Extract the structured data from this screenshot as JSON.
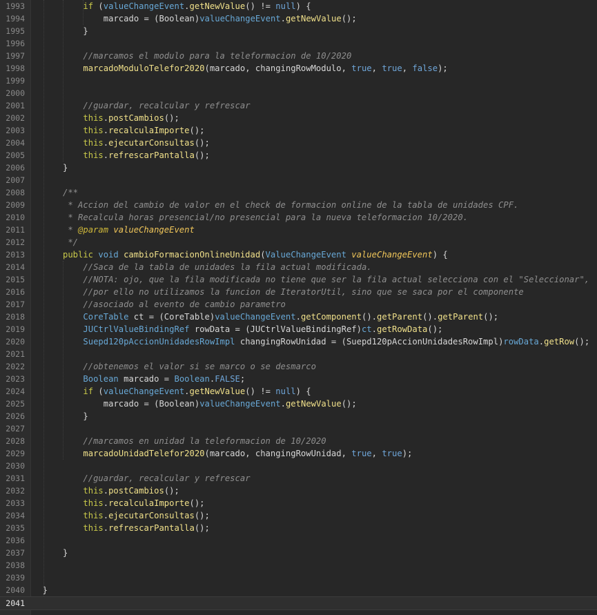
{
  "editor": {
    "current_line": "2041",
    "lines": [
      {
        "n": "1993",
        "indent": 4,
        "tokens": [
          [
            "kw",
            "if"
          ],
          [
            "pl",
            " ("
          ],
          [
            "ty",
            "valueChangeEvent"
          ],
          [
            "pl",
            "."
          ],
          [
            "fn",
            "getNewValue"
          ],
          [
            "pl",
            "() != "
          ],
          [
            "lt",
            "null"
          ],
          [
            "pl",
            ") {"
          ]
        ]
      },
      {
        "n": "1994",
        "indent": 8,
        "tokens": [
          [
            "pl",
            "marcado = (Boolean)"
          ],
          [
            "ty",
            "valueChangeEvent"
          ],
          [
            "pl",
            "."
          ],
          [
            "fn",
            "getNewValue"
          ],
          [
            "pl",
            "();"
          ]
        ]
      },
      {
        "n": "1995",
        "indent": 4,
        "tokens": [
          [
            "pl",
            "}"
          ]
        ]
      },
      {
        "n": "1996",
        "indent": 0,
        "tokens": []
      },
      {
        "n": "1997",
        "indent": 4,
        "tokens": [
          [
            "cm",
            "//marcamos el modulo para la teleformacion de 10/2020"
          ]
        ]
      },
      {
        "n": "1998",
        "indent": 4,
        "tokens": [
          [
            "fn",
            "marcadoModuloTelefor2020"
          ],
          [
            "pl",
            "(marcado, changingRowModulo, "
          ],
          [
            "lt",
            "true"
          ],
          [
            "pl",
            ", "
          ],
          [
            "lt",
            "true"
          ],
          [
            "pl",
            ", "
          ],
          [
            "lt",
            "false"
          ],
          [
            "pl",
            ");"
          ]
        ]
      },
      {
        "n": "1999",
        "indent": 0,
        "tokens": []
      },
      {
        "n": "2000",
        "indent": 0,
        "tokens": []
      },
      {
        "n": "2001",
        "indent": 4,
        "tokens": [
          [
            "cm",
            "//guardar, recalcular y refrescar"
          ]
        ]
      },
      {
        "n": "2002",
        "indent": 4,
        "tokens": [
          [
            "kw",
            "this"
          ],
          [
            "pl",
            "."
          ],
          [
            "fn",
            "postCambios"
          ],
          [
            "pl",
            "();"
          ]
        ]
      },
      {
        "n": "2003",
        "indent": 4,
        "tokens": [
          [
            "kw",
            "this"
          ],
          [
            "pl",
            "."
          ],
          [
            "fn",
            "recalculaImporte"
          ],
          [
            "pl",
            "();"
          ]
        ]
      },
      {
        "n": "2004",
        "indent": 4,
        "tokens": [
          [
            "kw",
            "this"
          ],
          [
            "pl",
            "."
          ],
          [
            "fn",
            "ejecutarConsultas"
          ],
          [
            "pl",
            "();"
          ]
        ]
      },
      {
        "n": "2005",
        "indent": 4,
        "tokens": [
          [
            "kw",
            "this"
          ],
          [
            "pl",
            "."
          ],
          [
            "fn",
            "refrescarPantalla"
          ],
          [
            "pl",
            "();"
          ]
        ]
      },
      {
        "n": "2006",
        "indent": 0,
        "tokens": [
          [
            "pl",
            "}"
          ]
        ]
      },
      {
        "n": "2007",
        "indent": 0,
        "tokens": []
      },
      {
        "n": "2008",
        "indent": 0,
        "tokens": [
          [
            "cm",
            "/**"
          ]
        ]
      },
      {
        "n": "2009",
        "indent": 0,
        "tokens": [
          [
            "cm",
            " * Accion del cambio de valor en el check de formacion online de la tabla de unidades CPF."
          ]
        ]
      },
      {
        "n": "2010",
        "indent": 0,
        "tokens": [
          [
            "cm",
            " * Recalcula horas presencial/no presencial para la nueva teleformacion 10/2020."
          ]
        ]
      },
      {
        "n": "2011",
        "indent": 0,
        "tokens": [
          [
            "cm",
            " * "
          ],
          [
            "an",
            "@param"
          ],
          [
            "cm",
            " "
          ],
          [
            "pn",
            "valueChangeEvent"
          ]
        ]
      },
      {
        "n": "2012",
        "indent": 0,
        "tokens": [
          [
            "cm",
            " */"
          ]
        ]
      },
      {
        "n": "2013",
        "indent": 0,
        "tokens": [
          [
            "kw",
            "public"
          ],
          [
            "pl",
            " "
          ],
          [
            "ty",
            "void"
          ],
          [
            "pl",
            " "
          ],
          [
            "fn",
            "cambioFormacionOnlineUnidad"
          ],
          [
            "pl",
            "("
          ],
          [
            "ty",
            "ValueChangeEvent"
          ],
          [
            "pl",
            " "
          ],
          [
            "pn",
            "valueChangeEvent"
          ],
          [
            "pl",
            ") {"
          ]
        ]
      },
      {
        "n": "2014",
        "indent": 4,
        "tokens": [
          [
            "cm",
            "//Saca de la tabla de unidades la fila actual modificada."
          ]
        ]
      },
      {
        "n": "2015",
        "indent": 4,
        "tokens": [
          [
            "cm",
            "//NOTA: ojo, que la fila modificada no tiene que ser la fila actual selecciona con el \"Seleccionar\","
          ]
        ]
      },
      {
        "n": "2016",
        "indent": 4,
        "tokens": [
          [
            "cm",
            "//por ello no utilizamos la funcion de IteratorUtil, sino que se saca por el componente"
          ]
        ]
      },
      {
        "n": "2017",
        "indent": 4,
        "tokens": [
          [
            "cm",
            "//asociado al evento de cambio parametro"
          ]
        ]
      },
      {
        "n": "2018",
        "indent": 4,
        "tokens": [
          [
            "ty",
            "CoreTable"
          ],
          [
            "pl",
            " ct = (CoreTable)"
          ],
          [
            "ty",
            "valueChangeEvent"
          ],
          [
            "pl",
            "."
          ],
          [
            "fn",
            "getComponent"
          ],
          [
            "pl",
            "()."
          ],
          [
            "fn",
            "getParent"
          ],
          [
            "pl",
            "()."
          ],
          [
            "fn",
            "getParent"
          ],
          [
            "pl",
            "();"
          ]
        ]
      },
      {
        "n": "2019",
        "indent": 4,
        "tokens": [
          [
            "ty",
            "JUCtrlValueBindingRef"
          ],
          [
            "pl",
            " rowData = (JUCtrlValueBindingRef)"
          ],
          [
            "ty",
            "ct"
          ],
          [
            "pl",
            "."
          ],
          [
            "fn",
            "getRowData"
          ],
          [
            "pl",
            "();"
          ]
        ]
      },
      {
        "n": "2020",
        "indent": 4,
        "tokens": [
          [
            "ty",
            "Suepd120pAccionUnidadesRowImpl"
          ],
          [
            "pl",
            " changingRowUnidad = (Suepd120pAccionUnidadesRowImpl)"
          ],
          [
            "ty",
            "rowData"
          ],
          [
            "pl",
            "."
          ],
          [
            "fn",
            "getRow"
          ],
          [
            "pl",
            "();"
          ]
        ]
      },
      {
        "n": "2021",
        "indent": 0,
        "tokens": []
      },
      {
        "n": "2022",
        "indent": 4,
        "tokens": [
          [
            "cm",
            "//obtenemos el valor si se marco o se desmarco"
          ]
        ]
      },
      {
        "n": "2023",
        "indent": 4,
        "tokens": [
          [
            "ty",
            "Boolean"
          ],
          [
            "pl",
            " marcado = "
          ],
          [
            "ty",
            "Boolean"
          ],
          [
            "pl",
            "."
          ],
          [
            "lt",
            "FALSE"
          ],
          [
            "pl",
            ";"
          ]
        ]
      },
      {
        "n": "2024",
        "indent": 4,
        "tokens": [
          [
            "kw",
            "if"
          ],
          [
            "pl",
            " ("
          ],
          [
            "ty",
            "valueChangeEvent"
          ],
          [
            "pl",
            "."
          ],
          [
            "fn",
            "getNewValue"
          ],
          [
            "pl",
            "() != "
          ],
          [
            "lt",
            "null"
          ],
          [
            "pl",
            ") {"
          ]
        ]
      },
      {
        "n": "2025",
        "indent": 8,
        "tokens": [
          [
            "pl",
            "marcado = (Boolean)"
          ],
          [
            "ty",
            "valueChangeEvent"
          ],
          [
            "pl",
            "."
          ],
          [
            "fn",
            "getNewValue"
          ],
          [
            "pl",
            "();"
          ]
        ]
      },
      {
        "n": "2026",
        "indent": 4,
        "tokens": [
          [
            "pl",
            "}"
          ]
        ]
      },
      {
        "n": "2027",
        "indent": 0,
        "tokens": []
      },
      {
        "n": "2028",
        "indent": 4,
        "tokens": [
          [
            "cm",
            "//marcamos en unidad la teleformacion de 10/2020"
          ]
        ]
      },
      {
        "n": "2029",
        "indent": 4,
        "tokens": [
          [
            "fn",
            "marcadoUnidadTelefor2020"
          ],
          [
            "pl",
            "(marcado, changingRowUnidad, "
          ],
          [
            "lt",
            "true"
          ],
          [
            "pl",
            ", "
          ],
          [
            "lt",
            "true"
          ],
          [
            "pl",
            ");"
          ]
        ]
      },
      {
        "n": "2030",
        "indent": 0,
        "tokens": []
      },
      {
        "n": "2031",
        "indent": 4,
        "tokens": [
          [
            "cm",
            "//guardar, recalcular y refrescar"
          ]
        ]
      },
      {
        "n": "2032",
        "indent": 4,
        "tokens": [
          [
            "kw",
            "this"
          ],
          [
            "pl",
            "."
          ],
          [
            "fn",
            "postCambios"
          ],
          [
            "pl",
            "();"
          ]
        ]
      },
      {
        "n": "2033",
        "indent": 4,
        "tokens": [
          [
            "kw",
            "this"
          ],
          [
            "pl",
            "."
          ],
          [
            "fn",
            "recalculaImporte"
          ],
          [
            "pl",
            "();"
          ]
        ]
      },
      {
        "n": "2034",
        "indent": 4,
        "tokens": [
          [
            "kw",
            "this"
          ],
          [
            "pl",
            "."
          ],
          [
            "fn",
            "ejecutarConsultas"
          ],
          [
            "pl",
            "();"
          ]
        ]
      },
      {
        "n": "2035",
        "indent": 4,
        "tokens": [
          [
            "kw",
            "this"
          ],
          [
            "pl",
            "."
          ],
          [
            "fn",
            "refrescarPantalla"
          ],
          [
            "pl",
            "();"
          ]
        ]
      },
      {
        "n": "2036",
        "indent": 0,
        "tokens": []
      },
      {
        "n": "2037",
        "indent": 0,
        "tokens": [
          [
            "pl",
            "}"
          ]
        ]
      },
      {
        "n": "2038",
        "indent": 0,
        "tokens": []
      },
      {
        "n": "2039",
        "indent": 0,
        "tokens": []
      },
      {
        "n": "2040",
        "indent": -4,
        "tokens": [
          [
            "pl",
            "}"
          ]
        ]
      },
      {
        "n": "2041",
        "indent": -4,
        "tokens": []
      }
    ]
  }
}
